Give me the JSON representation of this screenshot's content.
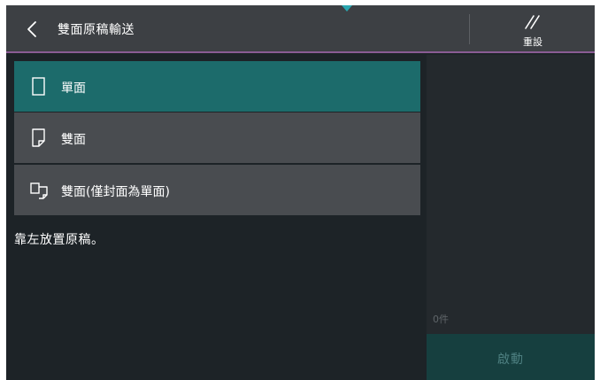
{
  "header": {
    "title": "雙面原稿輸送",
    "reset_label": "重設"
  },
  "options": [
    {
      "label": "單面",
      "icon": "single-sided-page-icon",
      "selected": true
    },
    {
      "label": "雙面",
      "icon": "double-sided-page-icon",
      "selected": false
    },
    {
      "label": "雙面(僅封面為單面)",
      "icon": "double-sided-cover-single-icon",
      "selected": false
    }
  ],
  "instruction": "靠左放置原稿。",
  "side_panel": {
    "count": "0件",
    "start_label": "啟動"
  },
  "colors": {
    "header_bg": "#3d4044",
    "accent_line": "#8a5c94",
    "selected_bg": "#1c6b6b",
    "option_bg": "#494c50",
    "screen_bg": "#1d2327",
    "start_bg": "#163f3f"
  }
}
